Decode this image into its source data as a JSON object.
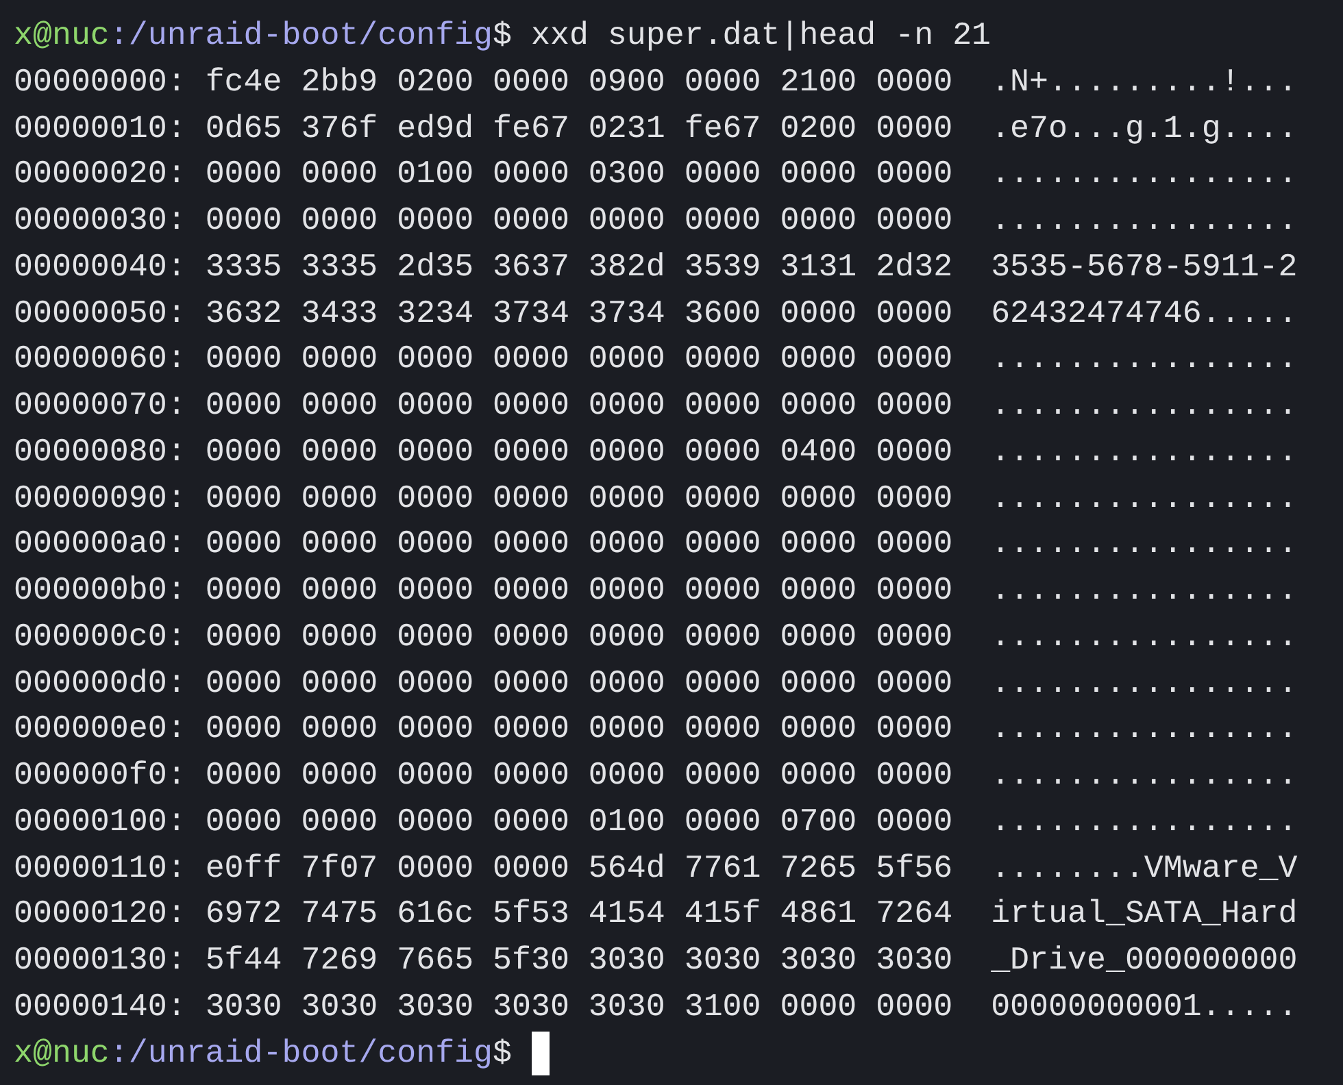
{
  "command_prompt": {
    "user_host": "x@nuc",
    "path": ":/unraid-boot/config",
    "symbol": "$",
    "command": "xxd super.dat|head -n 21"
  },
  "dump_rows": [
    {
      "offset": "00000000:",
      "hex": "fc4e 2bb9 0200 0000 0900 0000 2100 0000",
      "ascii": ".N+.........!..."
    },
    {
      "offset": "00000010:",
      "hex": "0d65 376f ed9d fe67 0231 fe67 0200 0000",
      "ascii": ".e7o...g.1.g...."
    },
    {
      "offset": "00000020:",
      "hex": "0000 0000 0100 0000 0300 0000 0000 0000",
      "ascii": "................"
    },
    {
      "offset": "00000030:",
      "hex": "0000 0000 0000 0000 0000 0000 0000 0000",
      "ascii": "................"
    },
    {
      "offset": "00000040:",
      "hex": "3335 3335 2d35 3637 382d 3539 3131 2d32",
      "ascii": "3535-5678-5911-2"
    },
    {
      "offset": "00000050:",
      "hex": "3632 3433 3234 3734 3734 3600 0000 0000",
      "ascii": "62432474746....."
    },
    {
      "offset": "00000060:",
      "hex": "0000 0000 0000 0000 0000 0000 0000 0000",
      "ascii": "................"
    },
    {
      "offset": "00000070:",
      "hex": "0000 0000 0000 0000 0000 0000 0000 0000",
      "ascii": "................"
    },
    {
      "offset": "00000080:",
      "hex": "0000 0000 0000 0000 0000 0000 0400 0000",
      "ascii": "................"
    },
    {
      "offset": "00000090:",
      "hex": "0000 0000 0000 0000 0000 0000 0000 0000",
      "ascii": "................"
    },
    {
      "offset": "000000a0:",
      "hex": "0000 0000 0000 0000 0000 0000 0000 0000",
      "ascii": "................"
    },
    {
      "offset": "000000b0:",
      "hex": "0000 0000 0000 0000 0000 0000 0000 0000",
      "ascii": "................"
    },
    {
      "offset": "000000c0:",
      "hex": "0000 0000 0000 0000 0000 0000 0000 0000",
      "ascii": "................"
    },
    {
      "offset": "000000d0:",
      "hex": "0000 0000 0000 0000 0000 0000 0000 0000",
      "ascii": "................"
    },
    {
      "offset": "000000e0:",
      "hex": "0000 0000 0000 0000 0000 0000 0000 0000",
      "ascii": "................"
    },
    {
      "offset": "000000f0:",
      "hex": "0000 0000 0000 0000 0000 0000 0000 0000",
      "ascii": "................"
    },
    {
      "offset": "00000100:",
      "hex": "0000 0000 0000 0000 0100 0000 0700 0000",
      "ascii": "................"
    },
    {
      "offset": "00000110:",
      "hex": "e0ff 7f07 0000 0000 564d 7761 7265 5f56",
      "ascii": "........VMware_V"
    },
    {
      "offset": "00000120:",
      "hex": "6972 7475 616c 5f53 4154 415f 4861 7264",
      "ascii": "irtual_SATA_Hard"
    },
    {
      "offset": "00000130:",
      "hex": "5f44 7269 7665 5f30 3030 3030 3030 3030",
      "ascii": "_Drive_000000000"
    },
    {
      "offset": "00000140:",
      "hex": "3030 3030 3030 3030 3030 3100 0000 0000",
      "ascii": "00000000001....."
    }
  ],
  "final_prompt": {
    "user_host": "x@nuc",
    "path": ":/unraid-boot/config",
    "symbol": "$"
  }
}
